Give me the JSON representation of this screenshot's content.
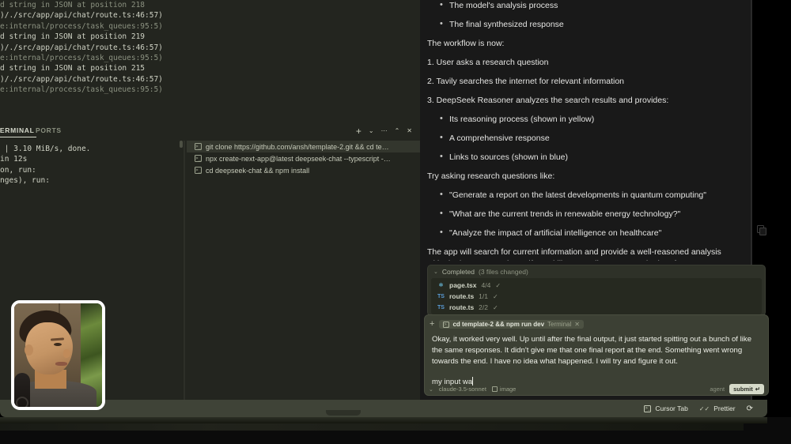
{
  "terminal": {
    "scrollback_lines": [
      "d string in JSON at position 218",
      "",
      ")/./src/app/api/chat/route.ts:46:57)",
      "e:internal/process/task_queues:95:5)",
      "d string in JSON at position 219",
      "",
      ")/./src/app/api/chat/route.ts:46:57)",
      "e:internal/process/task_queues:95:5)",
      "d string in JSON at position 215",
      "",
      ")/./src/app/api/chat/route.ts:46:57)",
      "e:internal/process/task_queues:95:5)"
    ],
    "tabs": [
      {
        "label": "TERMINAL",
        "active": true
      },
      {
        "label": "PORTS",
        "active": false
      }
    ],
    "actions": [
      {
        "name": "new-terminal-icon",
        "glyph": "+"
      },
      {
        "name": "chevron-down-icon",
        "glyph": "⌄"
      },
      {
        "name": "more-actions-icon",
        "glyph": "⋯"
      },
      {
        "name": "chevron-up-icon",
        "glyph": "⌃"
      },
      {
        "name": "close-icon",
        "glyph": "✕"
      }
    ],
    "body_lines": [
      " | 3.10 MiB/s, done.",
      "",
      "in 12s",
      "",
      "",
      "",
      "on, run:",
      "",
      "nges), run:"
    ],
    "tab_list": [
      {
        "label": "git clone https://github.com/ansh/template-2.git && cd te…",
        "selected": true
      },
      {
        "label": "npx create-next-app@latest deepseek-chat --typescript -…",
        "selected": false
      },
      {
        "label": "cd deepseek-chat && npm install",
        "selected": false
      }
    ]
  },
  "chat": {
    "blocks": [
      {
        "kind": "li",
        "text": "The model's analysis process"
      },
      {
        "kind": "li",
        "text": "The final synthesized response"
      },
      {
        "kind": "p",
        "text": "The workflow is now:"
      },
      {
        "kind": "ol",
        "text": "1. User asks a research question"
      },
      {
        "kind": "ol",
        "text": "2. Tavily searches the internet for relevant information"
      },
      {
        "kind": "ol",
        "text": "3. DeepSeek Reasoner analyzes the search results and provides:"
      },
      {
        "kind": "li",
        "text": "Its reasoning process (shown in yellow)"
      },
      {
        "kind": "li",
        "text": "A comprehensive response"
      },
      {
        "kind": "li",
        "text": "Links to sources (shown in blue)"
      },
      {
        "kind": "p",
        "text": "Try asking research questions like:"
      },
      {
        "kind": "li",
        "text": "\"Generate a report on the latest developments in quantum computing\""
      },
      {
        "kind": "li",
        "text": "\"What are the current trends in renewable energy technology?\""
      },
      {
        "kind": "li",
        "text": "\"Analyze the impact of artificial intelligence on healthcare\""
      },
      {
        "kind": "p",
        "text": "The app will search for current information and provide a well-reasoned analysis with citations. Let me know if you'd like any adjustments to the interface or functionality!"
      }
    ]
  },
  "files_card": {
    "status": "Completed",
    "count_label": "(3 files changed)",
    "rows": [
      {
        "icon": "react-icon",
        "name": "page.tsx",
        "count": "4/4",
        "check": "✓"
      },
      {
        "icon": "ts-icon",
        "name": "route.ts",
        "count": "1/1",
        "check": "✓"
      },
      {
        "icon": "ts-icon",
        "name": "route.ts",
        "count": "2/2",
        "check": "✓"
      }
    ]
  },
  "composer": {
    "add_label": "+",
    "context_chip": {
      "name": "cd template-2 && npm run dev",
      "kind": "Terminal",
      "close": "✕"
    },
    "message": "Okay, it worked very well. Up until after the final output, it just started spitting out a bunch of like the same responses. It didn't give me that one final report at the end. Something went wrong towards the end. I have no idea what happened. I will try and figure it out.",
    "draft": "my input wa",
    "model": "claude-3.5-sonnet",
    "image_label": "image",
    "mode": "agent",
    "submit_label": "submit",
    "submit_glyph": "↵"
  },
  "statusbar": {
    "items": [
      {
        "name": "cursor-tab",
        "icon": "terminal-icon",
        "label": "Cursor Tab"
      },
      {
        "name": "prettier",
        "icon": "check-check-icon",
        "label": "Prettier"
      }
    ],
    "sync_glyph": "⟳"
  },
  "colors": {
    "terminal_bg": "#23251f",
    "chat_bg": "#191919",
    "composer_bg": "#3c4034",
    "statusbar_bg": "#3f4337",
    "accent": "#d6dac9"
  }
}
